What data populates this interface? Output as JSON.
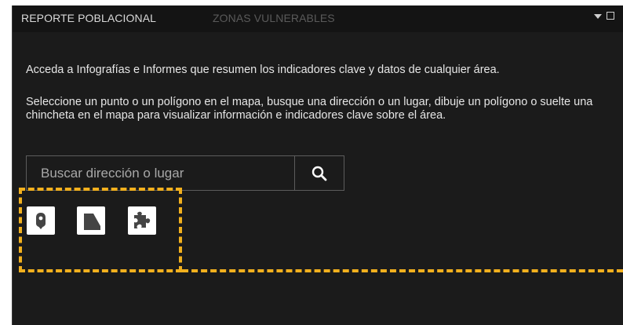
{
  "tabs": {
    "active": "REPORTE POBLACIONAL",
    "inactive": "ZONAS VULNERABLES"
  },
  "header_icons": [
    "caret-down-icon",
    "maximize-icon"
  ],
  "intro_text": "Acceda a Infografías e Informes que resumen los indicadores clave y datos de cualquier área.",
  "instructions_text": "Seleccione un punto o un polígono en el mapa, busque una dirección o un lugar, dibuje un polígono o suelte una chincheta en el mapa para visualizar información e indicadores clave sobre el área.",
  "search": {
    "placeholder": "Buscar dirección o lugar",
    "button_icon": "search-icon"
  },
  "tools": [
    {
      "icon": "pin-icon"
    },
    {
      "icon": "polygon-icon"
    },
    {
      "icon": "puzzle-icon"
    }
  ],
  "colors": {
    "panel_bg": "#1b1b1b",
    "header_bg": "#141414",
    "text": "#e6e6e6",
    "tab_inactive": "#5a5a5a",
    "highlight_dash": "#f2b01e"
  }
}
